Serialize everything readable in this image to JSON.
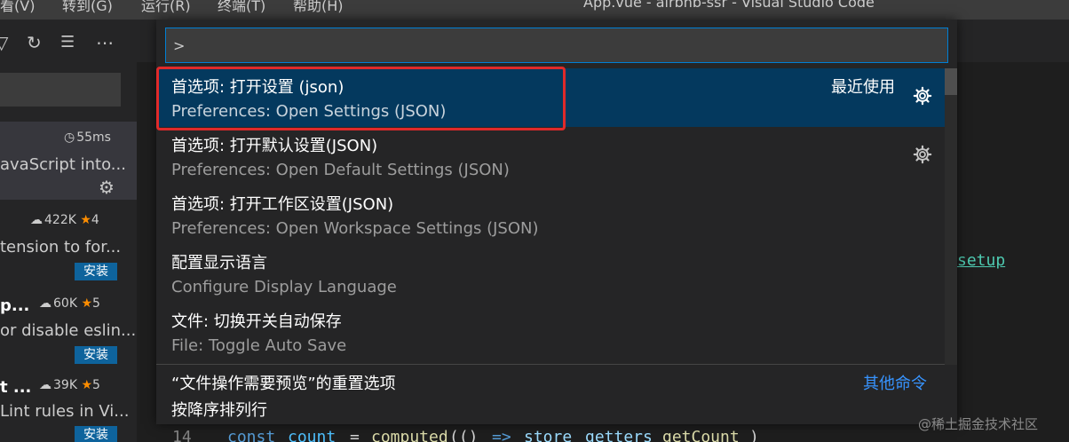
{
  "titlebar": {
    "menu": [
      "看(V)",
      "转到(G)",
      "运行(R)",
      "终端(T)",
      "帮助(H)"
    ],
    "window_title": "App.vue - airbnb-ssr - Visual Studio Code"
  },
  "sidebar": {
    "extensions": [
      {
        "time": "55ms",
        "desc": "avaScript into...",
        "selected": true
      },
      {
        "downloads": "422K",
        "rating": "4",
        "desc": "tension to for...",
        "install": "安装"
      },
      {
        "name": "p...",
        "downloads": "60K",
        "rating": "5",
        "desc": "or disable eslin...",
        "install": "安装"
      },
      {
        "name": "t ...",
        "downloads": "39K",
        "rating": "5",
        "desc": "Lint rules in Vi...",
        "install": "安装"
      }
    ]
  },
  "editor": {
    "line_number": "14",
    "code": {
      "kw": "const",
      "var": "count",
      "eq": "=",
      "fn": "computed",
      "paren": "(()",
      "arrow": "=>",
      "obj": "store",
      "prop1": "getters",
      "prop2": "getCount",
      "close": ")"
    },
    "setup_text": "setup"
  },
  "palette": {
    "input_value": ">",
    "items": [
      {
        "zh": "首选项: 打开设置 (json)",
        "en": "Preferences: Open Settings (JSON)",
        "badge": "最近使用",
        "active": true
      },
      {
        "zh": "首选项: 打开默认设置(JSON)",
        "en": "Preferences: Open Default Settings (JSON)"
      },
      {
        "zh": "首选项: 打开工作区设置(JSON)",
        "en": "Preferences: Open Workspace Settings (JSON)"
      },
      {
        "zh": "配置显示语言",
        "en": "Configure Display Language"
      },
      {
        "zh": "文件: 切换开关自动保存",
        "en": "File: Toggle Auto Save"
      },
      {
        "zh": "“文件操作需要预览”的重置选项",
        "en": "按降序排列行",
        "badge": "其他命令"
      }
    ]
  },
  "watermark": "@稀土掘金技术社区",
  "colors": {
    "accent": "#007fd4",
    "active_item": "#04395e",
    "highlight": "#e02a2a",
    "link": "#3794ff",
    "install": "#0e639c"
  }
}
